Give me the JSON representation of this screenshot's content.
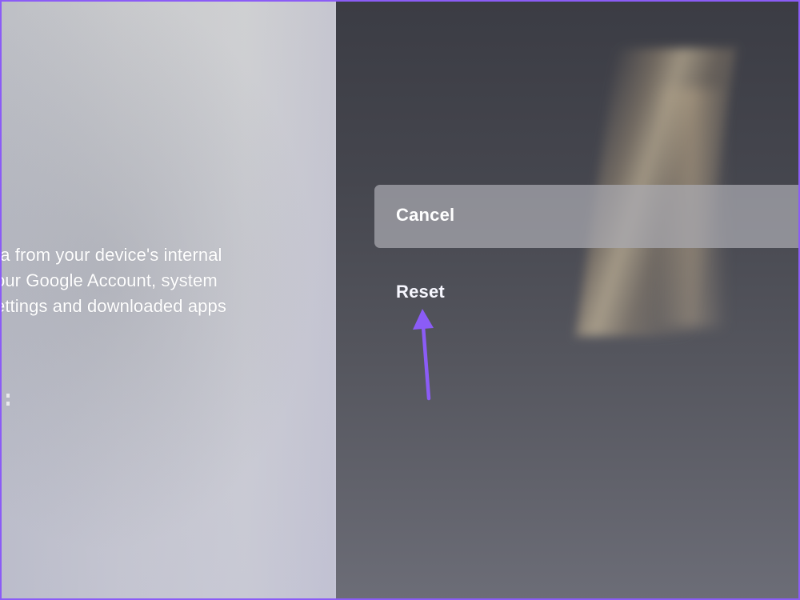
{
  "description": {
    "lines": [
      "ta from your device's internal",
      "our Google Account, system",
      "ettings and downloaded apps"
    ]
  },
  "actions": {
    "cancel_label": "Cancel",
    "reset_label": "Reset"
  },
  "colors": {
    "annotation_arrow": "#8b5cf6",
    "frame_border": "#8b5cf6"
  },
  "icons": {
    "annotation": "arrow-up-icon"
  }
}
